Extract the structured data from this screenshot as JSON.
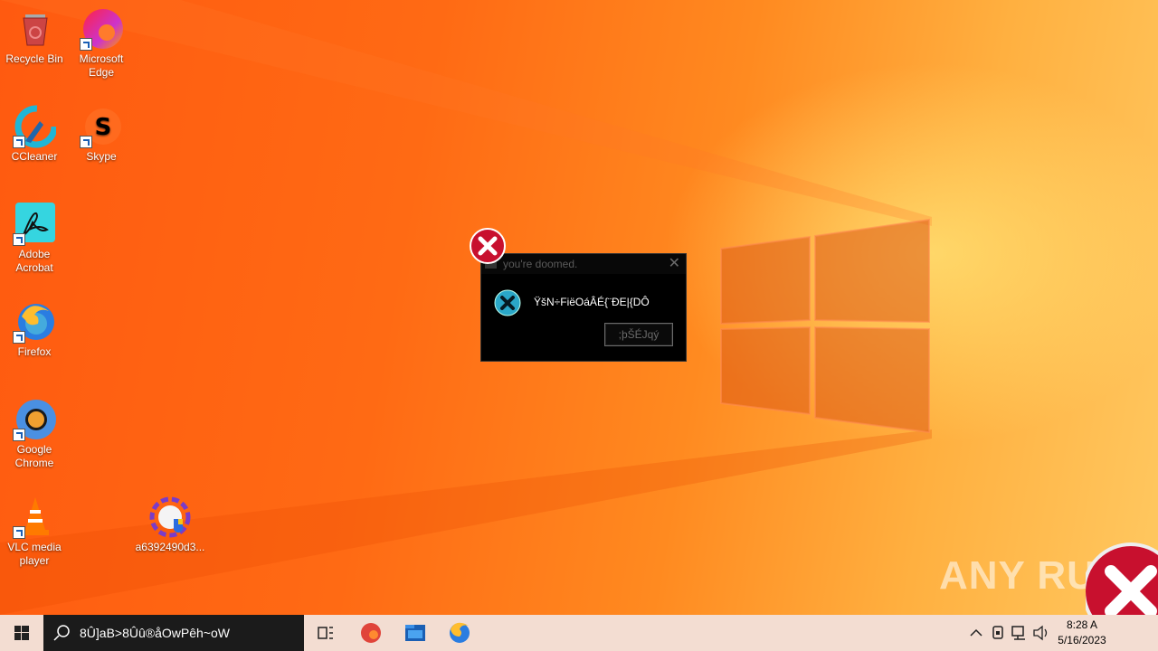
{
  "desktop_icons": [
    {
      "label": "Recycle Bin"
    },
    {
      "label": "Microsoft Edge"
    },
    {
      "label": "CCleaner"
    },
    {
      "label": "Skype"
    },
    {
      "label": "Adobe Acrobat"
    },
    {
      "label": "Firefox"
    },
    {
      "label": "Google Chrome"
    },
    {
      "label": "VLC media player"
    },
    {
      "label": "a6392490d3..."
    }
  ],
  "dialog": {
    "title": "you're doomed.",
    "message": "ŸšN÷FiëOáÂÉ{¨ÐE|{DÔ",
    "button_label": ";þŠÉJqý",
    "icon": "error-icon"
  },
  "watermark": "ANY RUN",
  "taskbar": {
    "search_text": "8Û]aB>8Ûû®åOwPêh~oW",
    "time": "8:28 A",
    "date": "5/16/2023",
    "pinned": [
      "task-view-icon",
      "edge-icon",
      "file-explorer-icon",
      "firefox-icon"
    ]
  },
  "colors": {
    "accent": "#ff5a10",
    "dialog_bg": "#000000",
    "taskbar_bg": "#f3ddd2",
    "error_red": "#c8102e"
  }
}
